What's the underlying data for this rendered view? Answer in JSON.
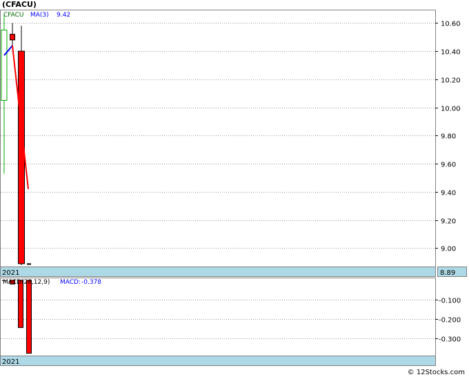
{
  "chart_title": "(CFACU)",
  "footer": "© 12Stocks.com",
  "colors": {
    "up": "#00aa00",
    "down": "#ff0000",
    "ma": "#0000ff",
    "macd": "#0000ff",
    "axis_band": "#add8e6",
    "grid": "#999999"
  },
  "chart_data": [
    {
      "type": "candlestick",
      "legend": {
        "symbol": "CFACU",
        "ma_label": "MA(3)",
        "ma_value": "9.42"
      },
      "year_label": "2021",
      "last_price_label": "8.89",
      "y_ticks": [
        "9.00",
        "9.20",
        "9.40",
        "9.60",
        "9.80",
        "10.00",
        "10.20",
        "10.40",
        "10.60"
      ],
      "ylim": [
        8.87,
        10.69
      ],
      "candles": [
        {
          "open": 10.05,
          "close": 10.55,
          "high": 10.66,
          "low": 9.53
        },
        {
          "open": 10.52,
          "close": 10.48,
          "high": 10.6,
          "low": 10.44
        },
        {
          "open": 10.4,
          "close": 8.89,
          "high": 10.58,
          "low": 8.88
        },
        {
          "open": 8.89,
          "close": 8.89,
          "high": 8.89,
          "low": 8.89
        }
      ],
      "ma": [
        10.37,
        10.44,
        null,
        9.42
      ]
    },
    {
      "type": "bar",
      "legend": {
        "label": "MACD(26,12,9)",
        "macd_label": "MACD:",
        "macd_value": "-0.378"
      },
      "year_label": "2021",
      "y_ticks": [
        "-0.100",
        "-0.200",
        "-0.300"
      ],
      "ylim": [
        -0.39,
        0.01
      ],
      "values": [
        0.0,
        -0.02,
        -0.245,
        -0.378
      ]
    }
  ]
}
